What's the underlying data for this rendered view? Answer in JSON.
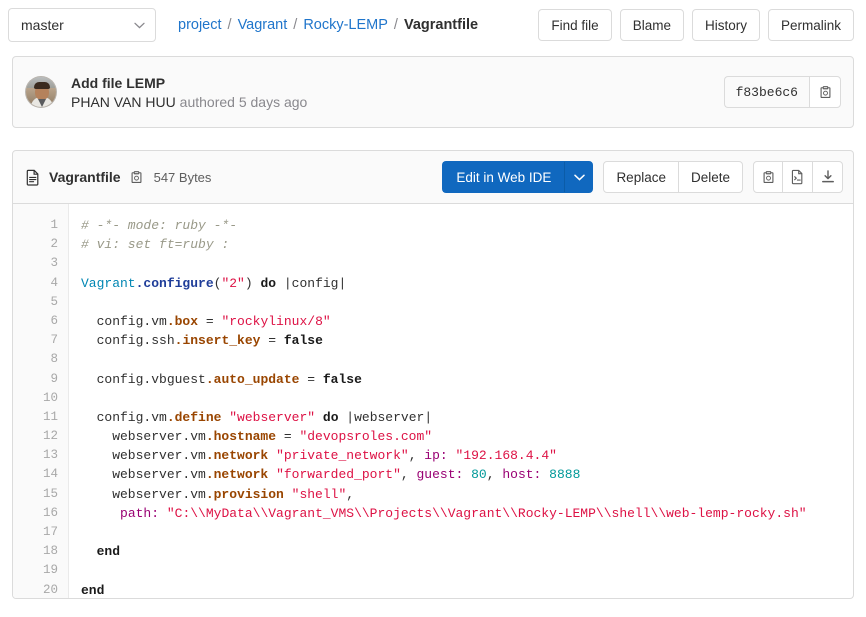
{
  "topbar": {
    "branch": "master",
    "breadcrumb": [
      {
        "label": "project",
        "current": false
      },
      {
        "label": "Vagrant",
        "current": false
      },
      {
        "label": "Rocky-LEMP",
        "current": false
      },
      {
        "label": "Vagrantfile",
        "current": true
      }
    ],
    "separator": "/",
    "actions": [
      {
        "label": "Find file"
      },
      {
        "label": "Blame"
      },
      {
        "label": "History"
      },
      {
        "label": "Permalink"
      }
    ]
  },
  "commit": {
    "title": "Add file LEMP",
    "author": "PHAN VAN HUU",
    "meta_suffix": "authored 5 days ago",
    "sha": "f83be6c6",
    "copy_icon": "clipboard-icon"
  },
  "file_header": {
    "file_icon": "document-icon",
    "name": "Vagrantfile",
    "copy_path_icon": "clipboard-icon",
    "size": "547 Bytes",
    "edit_label": "Edit in Web IDE",
    "edit_caret": "chevron-down-icon",
    "replace_label": "Replace",
    "delete_label": "Delete",
    "icon_buttons": [
      {
        "name": "copy-file-contents-icon"
      },
      {
        "name": "open-raw-icon"
      },
      {
        "name": "download-icon"
      }
    ]
  },
  "colors": {
    "accent_blue": "#1068bf",
    "link_blue": "#1f75cb",
    "border": "#dbdbdb",
    "panel_bg": "#fafafa",
    "text": "#303030",
    "muted": "#89888d",
    "syntax_comment": "#998998",
    "syntax_string": "#d14",
    "syntax_constant": "#0086b3",
    "syntax_method": "#1f3d99",
    "syntax_property": "#994500",
    "syntax_symbol": "#990073",
    "syntax_number": "#099"
  },
  "code": {
    "line_numbers": [
      1,
      2,
      3,
      4,
      5,
      6,
      7,
      8,
      9,
      10,
      11,
      12,
      13,
      14,
      15,
      16,
      17,
      18,
      19,
      20
    ],
    "lines": [
      [
        {
          "t": "# -*- mode: ruby -*-",
          "c": "c-com"
        }
      ],
      [
        {
          "t": "# vi: set ft=ruby :",
          "c": "c-com"
        }
      ],
      [],
      [
        {
          "t": "Vagrant",
          "c": "c-const"
        },
        {
          "t": ".configure",
          "c": "c-meth"
        },
        {
          "t": "(",
          "c": "c-punc"
        },
        {
          "t": "\"2\"",
          "c": "c-str"
        },
        {
          "t": ") ",
          "c": "c-punc"
        },
        {
          "t": "do",
          "c": "c-kw"
        },
        {
          "t": " |config|",
          "c": "c-plain"
        }
      ],
      [],
      [
        {
          "t": "  config",
          "c": "c-plain"
        },
        {
          "t": ".vm",
          "c": "c-plain"
        },
        {
          "t": ".box",
          "c": "c-prop"
        },
        {
          "t": " = ",
          "c": "c-punc"
        },
        {
          "t": "\"rockylinux/8\"",
          "c": "c-str"
        }
      ],
      [
        {
          "t": "  config",
          "c": "c-plain"
        },
        {
          "t": ".ssh",
          "c": "c-plain"
        },
        {
          "t": ".insert_key",
          "c": "c-prop"
        },
        {
          "t": " = ",
          "c": "c-punc"
        },
        {
          "t": "false",
          "c": "c-kw"
        }
      ],
      [],
      [
        {
          "t": "  config",
          "c": "c-plain"
        },
        {
          "t": ".vbguest",
          "c": "c-plain"
        },
        {
          "t": ".auto_update",
          "c": "c-prop"
        },
        {
          "t": " = ",
          "c": "c-punc"
        },
        {
          "t": "false",
          "c": "c-kw"
        }
      ],
      [],
      [
        {
          "t": "  config",
          "c": "c-plain"
        },
        {
          "t": ".vm",
          "c": "c-plain"
        },
        {
          "t": ".define",
          "c": "c-prop"
        },
        {
          "t": " ",
          "c": "c-punc"
        },
        {
          "t": "\"webserver\"",
          "c": "c-str"
        },
        {
          "t": " ",
          "c": "c-punc"
        },
        {
          "t": "do",
          "c": "c-kw"
        },
        {
          "t": " |webserver|",
          "c": "c-plain"
        }
      ],
      [
        {
          "t": "    webserver",
          "c": "c-plain"
        },
        {
          "t": ".vm",
          "c": "c-plain"
        },
        {
          "t": ".hostname",
          "c": "c-prop"
        },
        {
          "t": " = ",
          "c": "c-punc"
        },
        {
          "t": "\"devopsroles.com\"",
          "c": "c-str"
        }
      ],
      [
        {
          "t": "    webserver",
          "c": "c-plain"
        },
        {
          "t": ".vm",
          "c": "c-plain"
        },
        {
          "t": ".network",
          "c": "c-prop"
        },
        {
          "t": " ",
          "c": "c-punc"
        },
        {
          "t": "\"private_network\"",
          "c": "c-str"
        },
        {
          "t": ", ",
          "c": "c-punc"
        },
        {
          "t": "ip:",
          "c": "c-sym"
        },
        {
          "t": " ",
          "c": "c-punc"
        },
        {
          "t": "\"192.168.4.4\"",
          "c": "c-str"
        }
      ],
      [
        {
          "t": "    webserver",
          "c": "c-plain"
        },
        {
          "t": ".vm",
          "c": "c-plain"
        },
        {
          "t": ".network",
          "c": "c-prop"
        },
        {
          "t": " ",
          "c": "c-punc"
        },
        {
          "t": "\"forwarded_port\"",
          "c": "c-str"
        },
        {
          "t": ", ",
          "c": "c-punc"
        },
        {
          "t": "guest:",
          "c": "c-sym"
        },
        {
          "t": " ",
          "c": "c-punc"
        },
        {
          "t": "80",
          "c": "c-num"
        },
        {
          "t": ", ",
          "c": "c-punc"
        },
        {
          "t": "host:",
          "c": "c-sym"
        },
        {
          "t": " ",
          "c": "c-punc"
        },
        {
          "t": "8888",
          "c": "c-num"
        }
      ],
      [
        {
          "t": "    webserver",
          "c": "c-plain"
        },
        {
          "t": ".vm",
          "c": "c-plain"
        },
        {
          "t": ".provision",
          "c": "c-prop"
        },
        {
          "t": " ",
          "c": "c-punc"
        },
        {
          "t": "\"shell\"",
          "c": "c-str"
        },
        {
          "t": ",",
          "c": "c-punc"
        }
      ],
      [
        {
          "t": "     ",
          "c": "c-punc"
        },
        {
          "t": "path:",
          "c": "c-sym"
        },
        {
          "t": " ",
          "c": "c-punc"
        },
        {
          "t": "\"C:\\\\MyData\\\\Vagrant_VMS\\\\Projects\\\\Vagrant\\\\Rocky-LEMP\\\\shell\\\\web-lemp-rocky.sh\"",
          "c": "c-str"
        }
      ],
      [],
      [
        {
          "t": "  end",
          "c": "c-kw"
        }
      ],
      [],
      [
        {
          "t": "end",
          "c": "c-kw"
        }
      ]
    ]
  }
}
